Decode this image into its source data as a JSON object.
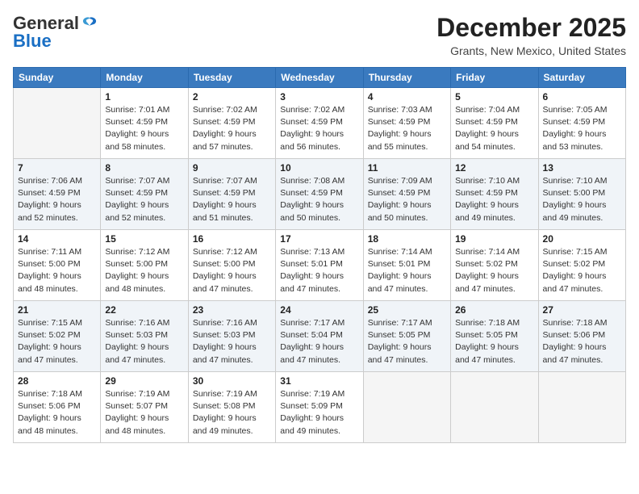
{
  "logo": {
    "line1": "General",
    "line2": "Blue"
  },
  "title": "December 2025",
  "location": "Grants, New Mexico, United States",
  "days_header": [
    "Sunday",
    "Monday",
    "Tuesday",
    "Wednesday",
    "Thursday",
    "Friday",
    "Saturday"
  ],
  "weeks": [
    [
      {
        "day": "",
        "info": ""
      },
      {
        "day": "1",
        "info": "Sunrise: 7:01 AM\nSunset: 4:59 PM\nDaylight: 9 hours\nand 58 minutes."
      },
      {
        "day": "2",
        "info": "Sunrise: 7:02 AM\nSunset: 4:59 PM\nDaylight: 9 hours\nand 57 minutes."
      },
      {
        "day": "3",
        "info": "Sunrise: 7:02 AM\nSunset: 4:59 PM\nDaylight: 9 hours\nand 56 minutes."
      },
      {
        "day": "4",
        "info": "Sunrise: 7:03 AM\nSunset: 4:59 PM\nDaylight: 9 hours\nand 55 minutes."
      },
      {
        "day": "5",
        "info": "Sunrise: 7:04 AM\nSunset: 4:59 PM\nDaylight: 9 hours\nand 54 minutes."
      },
      {
        "day": "6",
        "info": "Sunrise: 7:05 AM\nSunset: 4:59 PM\nDaylight: 9 hours\nand 53 minutes."
      }
    ],
    [
      {
        "day": "7",
        "info": "Sunrise: 7:06 AM\nSunset: 4:59 PM\nDaylight: 9 hours\nand 52 minutes."
      },
      {
        "day": "8",
        "info": "Sunrise: 7:07 AM\nSunset: 4:59 PM\nDaylight: 9 hours\nand 52 minutes."
      },
      {
        "day": "9",
        "info": "Sunrise: 7:07 AM\nSunset: 4:59 PM\nDaylight: 9 hours\nand 51 minutes."
      },
      {
        "day": "10",
        "info": "Sunrise: 7:08 AM\nSunset: 4:59 PM\nDaylight: 9 hours\nand 50 minutes."
      },
      {
        "day": "11",
        "info": "Sunrise: 7:09 AM\nSunset: 4:59 PM\nDaylight: 9 hours\nand 50 minutes."
      },
      {
        "day": "12",
        "info": "Sunrise: 7:10 AM\nSunset: 4:59 PM\nDaylight: 9 hours\nand 49 minutes."
      },
      {
        "day": "13",
        "info": "Sunrise: 7:10 AM\nSunset: 5:00 PM\nDaylight: 9 hours\nand 49 minutes."
      }
    ],
    [
      {
        "day": "14",
        "info": "Sunrise: 7:11 AM\nSunset: 5:00 PM\nDaylight: 9 hours\nand 48 minutes."
      },
      {
        "day": "15",
        "info": "Sunrise: 7:12 AM\nSunset: 5:00 PM\nDaylight: 9 hours\nand 48 minutes."
      },
      {
        "day": "16",
        "info": "Sunrise: 7:12 AM\nSunset: 5:00 PM\nDaylight: 9 hours\nand 47 minutes."
      },
      {
        "day": "17",
        "info": "Sunrise: 7:13 AM\nSunset: 5:01 PM\nDaylight: 9 hours\nand 47 minutes."
      },
      {
        "day": "18",
        "info": "Sunrise: 7:14 AM\nSunset: 5:01 PM\nDaylight: 9 hours\nand 47 minutes."
      },
      {
        "day": "19",
        "info": "Sunrise: 7:14 AM\nSunset: 5:02 PM\nDaylight: 9 hours\nand 47 minutes."
      },
      {
        "day": "20",
        "info": "Sunrise: 7:15 AM\nSunset: 5:02 PM\nDaylight: 9 hours\nand 47 minutes."
      }
    ],
    [
      {
        "day": "21",
        "info": "Sunrise: 7:15 AM\nSunset: 5:02 PM\nDaylight: 9 hours\nand 47 minutes."
      },
      {
        "day": "22",
        "info": "Sunrise: 7:16 AM\nSunset: 5:03 PM\nDaylight: 9 hours\nand 47 minutes."
      },
      {
        "day": "23",
        "info": "Sunrise: 7:16 AM\nSunset: 5:03 PM\nDaylight: 9 hours\nand 47 minutes."
      },
      {
        "day": "24",
        "info": "Sunrise: 7:17 AM\nSunset: 5:04 PM\nDaylight: 9 hours\nand 47 minutes."
      },
      {
        "day": "25",
        "info": "Sunrise: 7:17 AM\nSunset: 5:05 PM\nDaylight: 9 hours\nand 47 minutes."
      },
      {
        "day": "26",
        "info": "Sunrise: 7:18 AM\nSunset: 5:05 PM\nDaylight: 9 hours\nand 47 minutes."
      },
      {
        "day": "27",
        "info": "Sunrise: 7:18 AM\nSunset: 5:06 PM\nDaylight: 9 hours\nand 47 minutes."
      }
    ],
    [
      {
        "day": "28",
        "info": "Sunrise: 7:18 AM\nSunset: 5:06 PM\nDaylight: 9 hours\nand 48 minutes."
      },
      {
        "day": "29",
        "info": "Sunrise: 7:19 AM\nSunset: 5:07 PM\nDaylight: 9 hours\nand 48 minutes."
      },
      {
        "day": "30",
        "info": "Sunrise: 7:19 AM\nSunset: 5:08 PM\nDaylight: 9 hours\nand 49 minutes."
      },
      {
        "day": "31",
        "info": "Sunrise: 7:19 AM\nSunset: 5:09 PM\nDaylight: 9 hours\nand 49 minutes."
      },
      {
        "day": "",
        "info": ""
      },
      {
        "day": "",
        "info": ""
      },
      {
        "day": "",
        "info": ""
      }
    ]
  ]
}
